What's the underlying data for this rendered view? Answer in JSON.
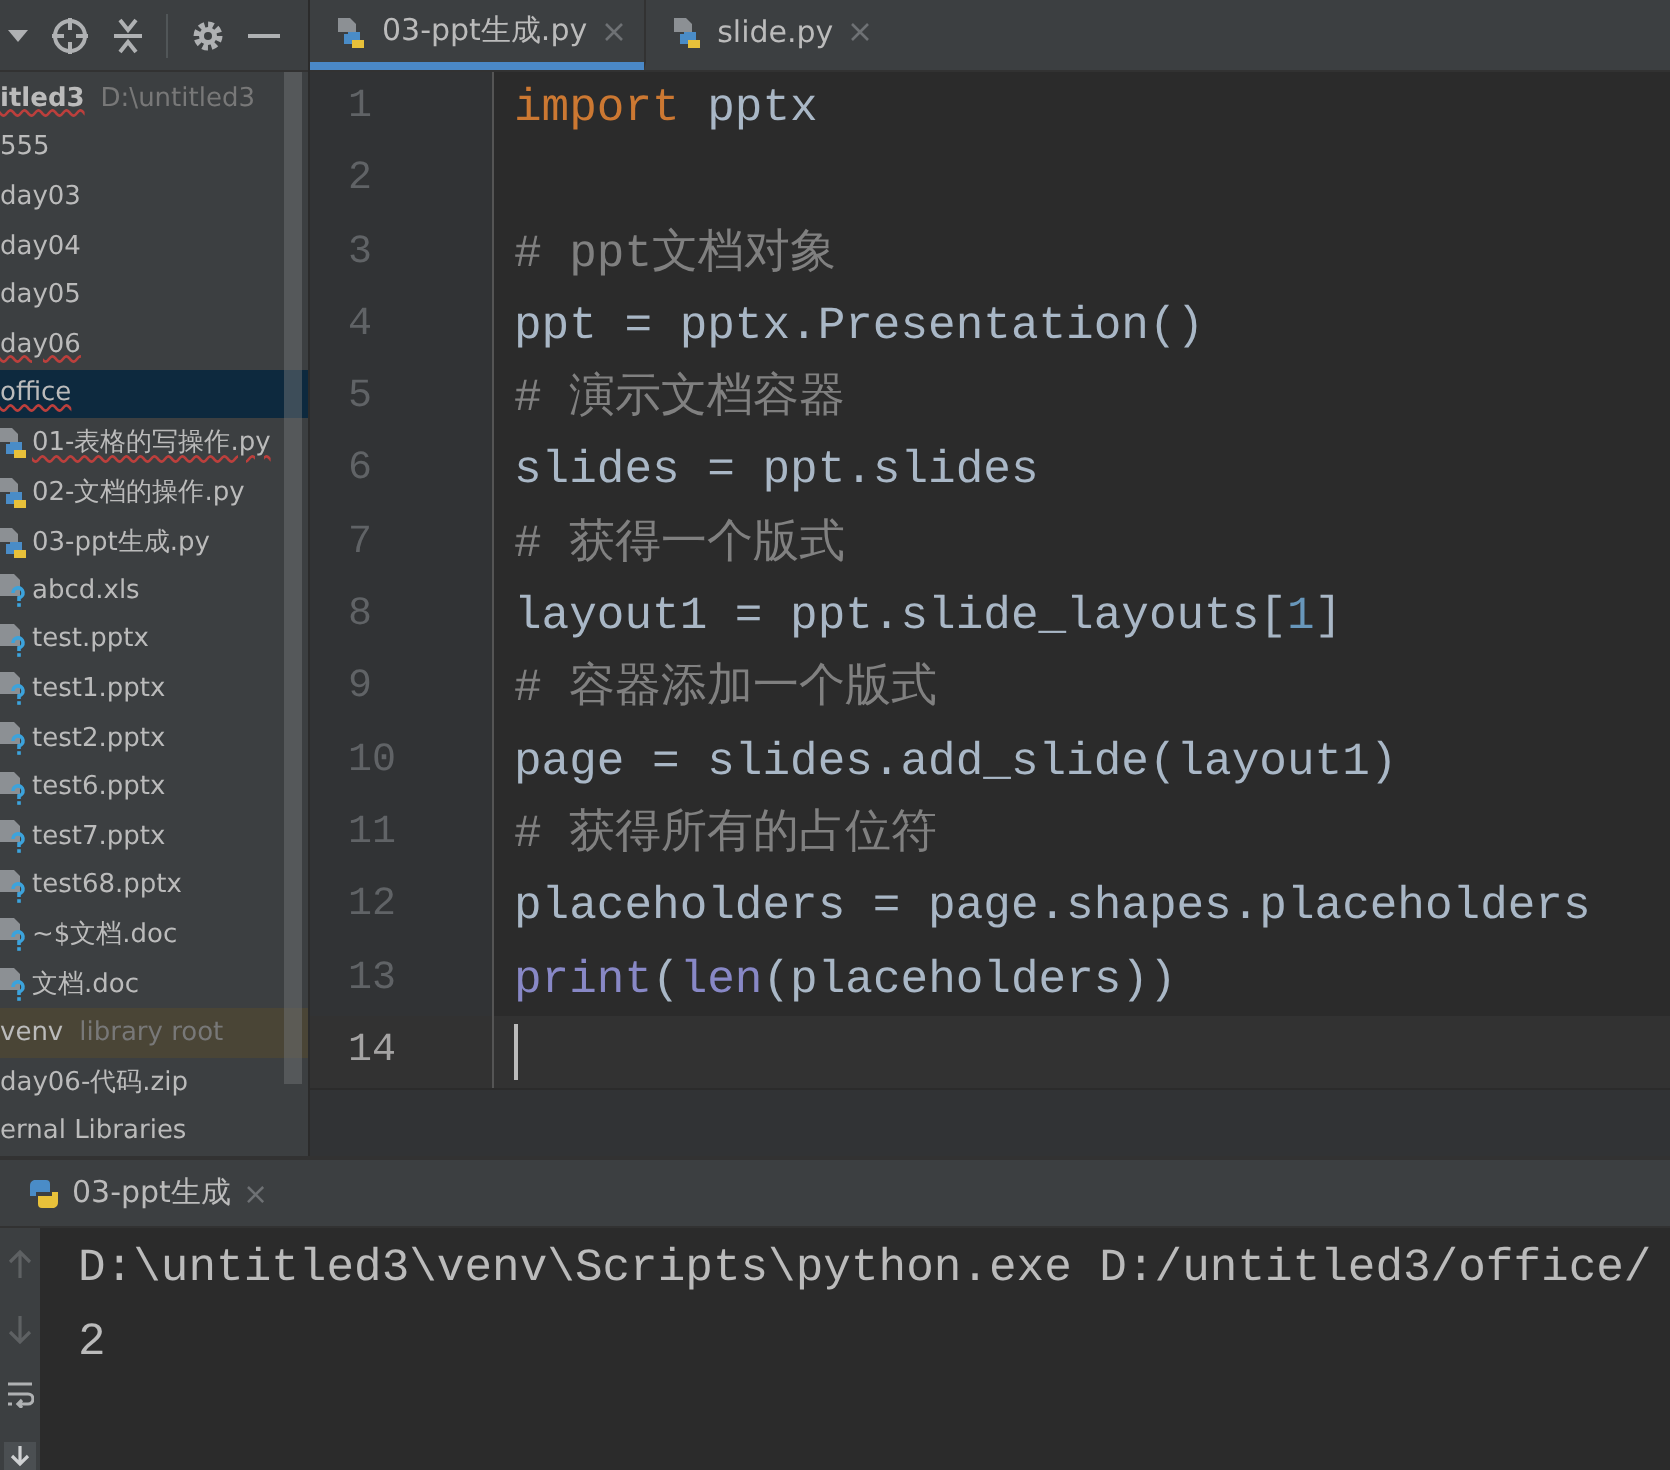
{
  "project_tree": {
    "items": [
      {
        "label": "itled3",
        "hint": "D:\\untitled3",
        "kind": "folder",
        "selected": false,
        "error": true
      },
      {
        "label": "555",
        "kind": "folder",
        "selected": false,
        "error": false
      },
      {
        "label": "day03",
        "kind": "folder",
        "selected": false,
        "error": false
      },
      {
        "label": "day04",
        "kind": "folder",
        "selected": false,
        "error": false
      },
      {
        "label": "day05",
        "kind": "folder",
        "selected": false,
        "error": false
      },
      {
        "label": "day06",
        "kind": "folder",
        "selected": false,
        "error": true
      },
      {
        "label": "office",
        "kind": "folder",
        "selected": true,
        "error": true
      },
      {
        "label": "01-表格的写操作.py",
        "kind": "python",
        "selected": false,
        "error": true
      },
      {
        "label": "02-文档的操作.py",
        "kind": "python",
        "selected": false,
        "error": false
      },
      {
        "label": "03-ppt生成.py",
        "kind": "python",
        "selected": false,
        "error": false
      },
      {
        "label": "abcd.xls",
        "kind": "unknown",
        "selected": false,
        "error": false
      },
      {
        "label": "test.pptx",
        "kind": "unknown",
        "selected": false,
        "error": false
      },
      {
        "label": "test1.pptx",
        "kind": "unknown",
        "selected": false,
        "error": false
      },
      {
        "label": "test2.pptx",
        "kind": "unknown",
        "selected": false,
        "error": false
      },
      {
        "label": "test6.pptx",
        "kind": "unknown",
        "selected": false,
        "error": false
      },
      {
        "label": "test7.pptx",
        "kind": "unknown",
        "selected": false,
        "error": false
      },
      {
        "label": "test68.pptx",
        "kind": "unknown",
        "selected": false,
        "error": false
      },
      {
        "label": "~$文档.doc",
        "kind": "unknown",
        "selected": false,
        "error": false
      },
      {
        "label": "文档.doc",
        "kind": "unknown",
        "selected": false,
        "error": false
      },
      {
        "label": "venv",
        "hint": "library root",
        "kind": "library",
        "selected": false,
        "error": false
      },
      {
        "label": "day06-代码.zip",
        "kind": "folder",
        "selected": false,
        "error": false
      },
      {
        "label": "ernal Libraries",
        "kind": "folder",
        "selected": false,
        "error": false
      }
    ]
  },
  "editor": {
    "tabs": [
      {
        "label": "03-ppt生成.py",
        "selected": true
      },
      {
        "label": "slide.py",
        "selected": false
      }
    ],
    "lines": [
      {
        "number": "1",
        "tokens": [
          {
            "text": "import",
            "kind": "keyword"
          },
          {
            "text": " pptx",
            "kind": "plain"
          }
        ]
      },
      {
        "number": "2"
      },
      {
        "number": "3",
        "tokens": [
          {
            "text": "# ppt文档对象",
            "kind": "comment"
          }
        ]
      },
      {
        "number": "4",
        "tokens": [
          {
            "text": "ppt = pptx.Presentation()",
            "kind": "plain"
          }
        ]
      },
      {
        "number": "5",
        "tokens": [
          {
            "text": "# 演示文档容器",
            "kind": "comment"
          }
        ]
      },
      {
        "number": "6",
        "tokens": [
          {
            "text": "slides = ppt.slides",
            "kind": "plain"
          }
        ]
      },
      {
        "number": "7",
        "tokens": [
          {
            "text": "# 获得一个版式",
            "kind": "comment"
          }
        ]
      },
      {
        "number": "8",
        "tokens": [
          {
            "text": "layout1 = ppt.slide_layouts[",
            "kind": "plain"
          },
          {
            "text": "1",
            "kind": "number"
          },
          {
            "text": "]",
            "kind": "plain"
          }
        ]
      },
      {
        "number": "9",
        "tokens": [
          {
            "text": "# 容器添加一个版式",
            "kind": "comment"
          }
        ]
      },
      {
        "number": "10",
        "tokens": [
          {
            "text": "page = slides.add_slide(layout1)",
            "kind": "plain"
          }
        ]
      },
      {
        "number": "11",
        "tokens": [
          {
            "text": "# 获得所有的占位符",
            "kind": "comment"
          }
        ]
      },
      {
        "number": "12",
        "tokens": [
          {
            "text": "placeholders = page.shapes.placeholders",
            "kind": "plain"
          }
        ]
      },
      {
        "number": "13",
        "tokens": [
          {
            "text": "print",
            "kind": "builtin"
          },
          {
            "text": "(",
            "kind": "plain"
          },
          {
            "text": "len",
            "kind": "builtin"
          },
          {
            "text": "(placeholders))",
            "kind": "plain"
          }
        ]
      },
      {
        "number": "14",
        "current": true
      }
    ]
  },
  "run_panel": {
    "tab": {
      "label": "03-ppt生成",
      "close": "×"
    },
    "output": [
      "D:\\untitled3\\venv\\Scripts\\python.exe D:/untitled3/office/",
      "2"
    ]
  }
}
